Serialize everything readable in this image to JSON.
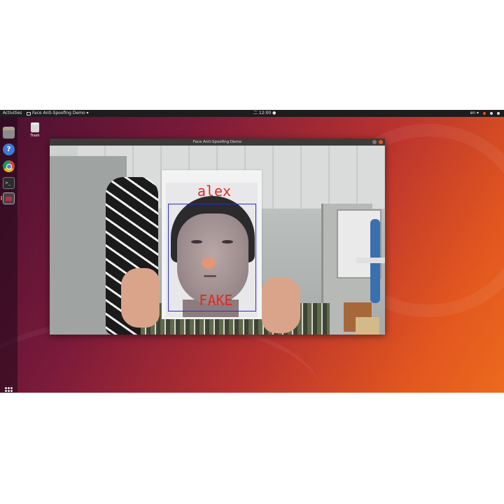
{
  "topbar": {
    "activities": "Activities",
    "app_menu": "Face Anti-Spoofing Demo ▾",
    "clock": "二 12:00 ●",
    "input_method": "en ▾"
  },
  "dock": {
    "items": [
      "files-icon",
      "help-icon",
      "chrome-icon",
      "terminal-icon",
      "screen-app-icon"
    ],
    "help_glyph": "?",
    "terminal_glyph": ">_"
  },
  "desktop": {
    "trash_label": "Trash"
  },
  "window": {
    "title": "Face Anti-Spoofing Demo",
    "detection": {
      "name": "alex",
      "result": "FAKE",
      "box_color": "#2b2bd8",
      "text_color": "#e8261f"
    }
  },
  "colors": {
    "accent": "#e95420",
    "panel": "#1d1d1d",
    "titlebar": "#3c3b37"
  }
}
